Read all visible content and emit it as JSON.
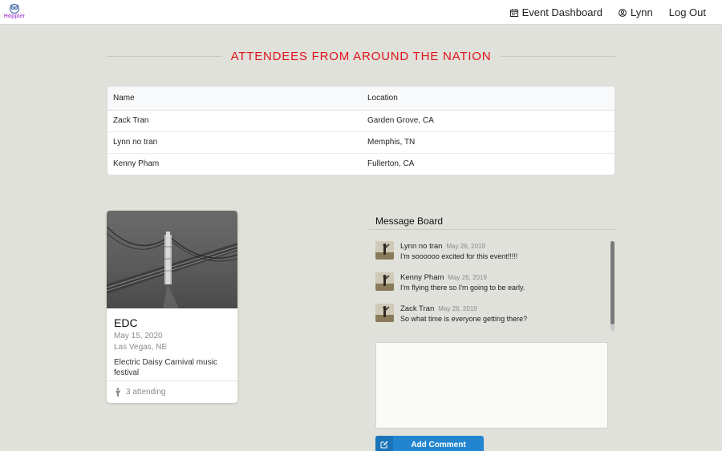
{
  "app": {
    "logo_text": "Hoppier"
  },
  "nav": {
    "dashboard_label": "Event Dashboard",
    "user_label": "Lynn",
    "logout_label": "Log Out"
  },
  "attendees": {
    "title": "ATTENDEES FROM AROUND THE NATION",
    "columns": [
      "Name",
      "Location"
    ],
    "rows": [
      {
        "name": "Zack Tran",
        "location": "Garden Grove, CA"
      },
      {
        "name": "Lynn no tran",
        "location": "Memphis, TN"
      },
      {
        "name": "Kenny Pham",
        "location": "Fullerton, CA"
      }
    ]
  },
  "event": {
    "title": "EDC",
    "date": "May 15, 2020",
    "location": "Las Vegas, NE",
    "description": "Electric Daisy Carnival music festival",
    "attending": "3 attending"
  },
  "message_board": {
    "title": "Message Board",
    "comments": [
      {
        "author": "Lynn no tran",
        "date": "May 26, 2019",
        "text": "I'm soooooo excited for this event!!!!!"
      },
      {
        "author": "Kenny Pham",
        "date": "May 26, 2019",
        "text": "I'm flying there so I'm going to be early."
      },
      {
        "author": "Zack Tran",
        "date": "May 26, 2019",
        "text": "So what time is everyone getting there?"
      }
    ],
    "comment_value": "",
    "add_button_label": "Add Comment"
  },
  "colors": {
    "accent_red": "#e0121b",
    "button_blue": "#2185d0",
    "page_bg": "#e0e1da",
    "logo_purple": "#b05ad8"
  },
  "icons": {
    "logo": "owl-logo-icon",
    "dashboard": "calendar-icon",
    "user": "user-circle-icon",
    "attending": "person-icon",
    "add_comment": "edit-icon"
  }
}
